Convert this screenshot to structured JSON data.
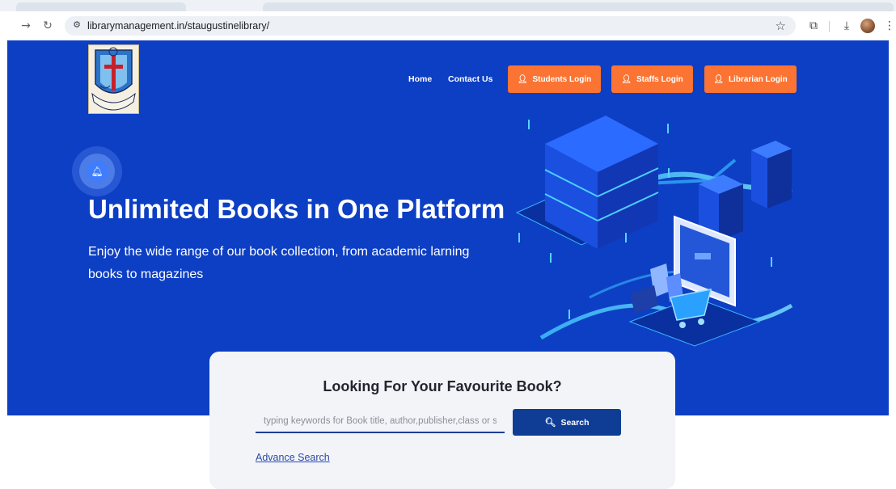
{
  "browser": {
    "url": "librarymanagement.in/staugustinelibrary/",
    "icons": {
      "back": "back-arrow-icon",
      "reload": "reload-icon",
      "site_info": "site-info-icon",
      "bookmark": "star-icon",
      "extensions": "puzzle-icon",
      "downloads": "download-icon",
      "menu": "more-vert-icon"
    }
  },
  "nav": {
    "home": "Home",
    "contact": "Contact Us",
    "students_login": "Students Login",
    "staffs_login": "Staffs Login",
    "librarian_login": "Librarian Login"
  },
  "hero": {
    "title": "Unlimited Books in One Platform",
    "subtitle": "Enjoy the wide range of our book collection, from academic larning books to magazines"
  },
  "search": {
    "heading": "Looking For Your Favourite Book?",
    "placeholder": "typing keywords for Book title, author,publisher,class or sub",
    "button": "Search",
    "advance": "Advance Search"
  },
  "colors": {
    "hero_bg": "#0d3fc4",
    "login_btn": "#fb7433",
    "search_btn": "#0f3d95"
  }
}
